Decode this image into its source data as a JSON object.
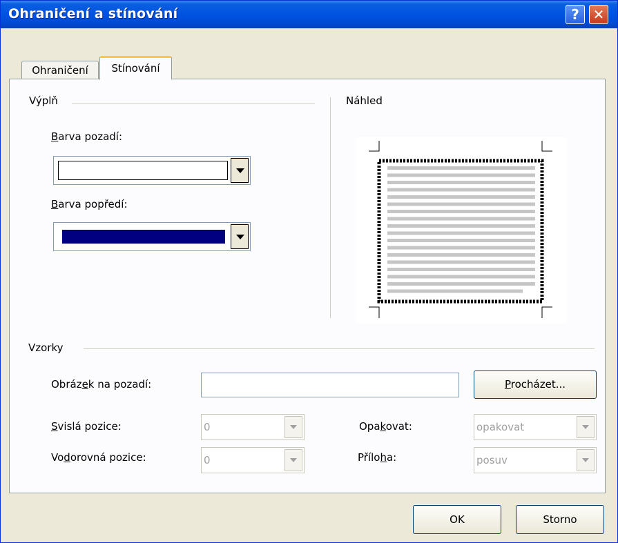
{
  "window": {
    "title": "Ohraničení a stínování"
  },
  "tabs": [
    {
      "label": "Ohraničení",
      "active": false
    },
    {
      "label": "Stínování",
      "active": true
    }
  ],
  "fill_group": {
    "label": "Výplň",
    "background_color_label": "Barva pozadí:",
    "background_color": "#ffffff",
    "foreground_color_label": "Barva popředí:",
    "foreground_color": "#000080"
  },
  "preview": {
    "label": "Náhled"
  },
  "patterns_group": {
    "label": "Vzorky",
    "background_image_label": "Obrázek na pozadí:",
    "background_image_value": "",
    "browse_label": "Procházet...",
    "vertical_position_label": "Svislá pozice:",
    "vertical_position_value": "0",
    "horizontal_position_label": "Vodorovná pozice:",
    "horizontal_position_value": "0",
    "repeat_label": "Opakovat:",
    "repeat_value": "opakovat",
    "attachment_label": "Příloha:",
    "attachment_value": "posuv"
  },
  "buttons": {
    "ok": "OK",
    "cancel": "Storno"
  },
  "icons": {
    "help": "help-icon",
    "close": "close-icon"
  }
}
